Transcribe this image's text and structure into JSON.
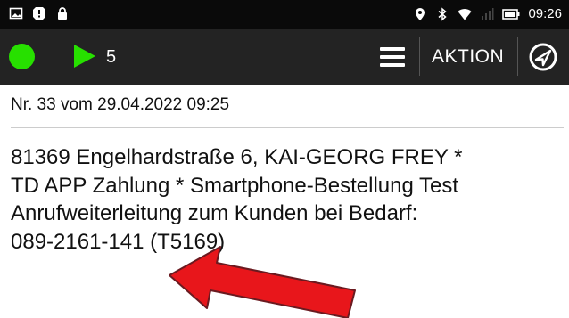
{
  "status_bar": {
    "time": "09:26",
    "icons": [
      "gallery-icon",
      "alert-icon",
      "lock-icon",
      "location-icon",
      "bluetooth-icon",
      "wifi-icon",
      "signal-icon",
      "battery-icon"
    ]
  },
  "app_bar": {
    "status_color": "#27e000",
    "play_color": "#27e000",
    "queue_count": "5",
    "action_label": "AKTION"
  },
  "order": {
    "header": "Nr. 33 vom 29.04.2022 09:25",
    "lines": [
      "81369 Engelhardstraße 6, KAI-GEORG FREY *",
      "TD APP Zahlung * Smartphone-Bestellung Test",
      "Anrufweiterleitung zum Kunden bei Bedarf:",
      "089-2161-141 (T5169)"
    ]
  },
  "annotation": {
    "arrow_color": "#e8161b"
  }
}
